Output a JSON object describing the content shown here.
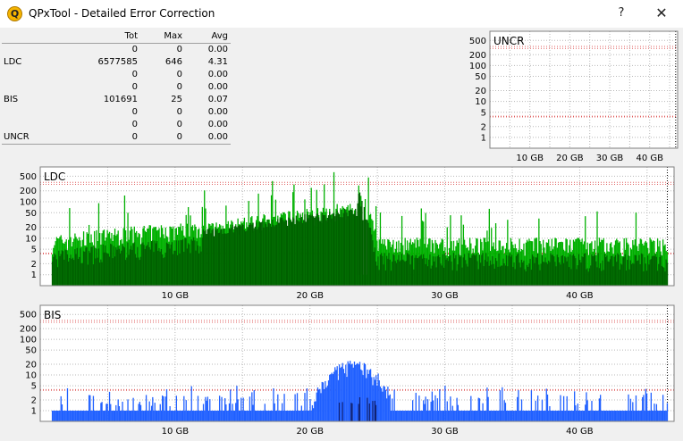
{
  "window": {
    "title": "QPxTool - Detailed Error Correction",
    "help_label": "?",
    "close_label": "✕"
  },
  "stats": {
    "headers": [
      "",
      "Tot",
      "Max",
      "Avg"
    ],
    "rows": [
      {
        "label": "",
        "tot": "0",
        "max": "0",
        "avg": "0.00"
      },
      {
        "label": "LDC",
        "tot": "6577585",
        "max": "646",
        "avg": "4.31"
      },
      {
        "label": "",
        "tot": "0",
        "max": "0",
        "avg": "0.00"
      },
      {
        "label": "",
        "tot": "0",
        "max": "0",
        "avg": "0.00"
      },
      {
        "label": "BIS",
        "tot": "101691",
        "max": "25",
        "avg": "0.07"
      },
      {
        "label": "",
        "tot": "0",
        "max": "0",
        "avg": "0.00"
      },
      {
        "label": "",
        "tot": "0",
        "max": "0",
        "avg": "0.00"
      },
      {
        "label": "UNCR",
        "tot": "0",
        "max": "0",
        "avg": "0.00"
      }
    ]
  },
  "chart_data": [
    {
      "type": "bar",
      "title": "UNCR",
      "y_scale": "log",
      "y_ticks": [
        "500",
        "200",
        "100",
        "50",
        "20",
        "10",
        "5",
        "2",
        "1"
      ],
      "x_ticks": [
        "10 GB",
        "20 GB",
        "30 GB",
        "40 GB"
      ],
      "xlim": [
        0,
        47
      ],
      "series": [
        {
          "values": []
        }
      ]
    },
    {
      "type": "bar",
      "title": "LDC",
      "y_scale": "log",
      "y_ticks": [
        "500",
        "200",
        "100",
        "50",
        "20",
        "10",
        "5",
        "2",
        "1"
      ],
      "x_ticks": [
        "10 GB",
        "20 GB",
        "30 GB",
        "40 GB"
      ],
      "xlim": [
        0,
        47
      ],
      "max_at_gb": 23.5,
      "max_value": 646,
      "colors": {
        "light": "#00b000",
        "dark": "#006000"
      }
    },
    {
      "type": "bar",
      "title": "BIS",
      "y_scale": "log",
      "y_ticks": [
        "500",
        "200",
        "100",
        "50",
        "20",
        "10",
        "5",
        "2",
        "1"
      ],
      "x_ticks": [
        "10 GB",
        "20 GB",
        "30 GB",
        "40 GB"
      ],
      "xlim": [
        0,
        47
      ],
      "max_at_gb": 23.2,
      "max_value": 25,
      "colors": {
        "light": "#2060ff",
        "dark": "#102070"
      }
    }
  ]
}
